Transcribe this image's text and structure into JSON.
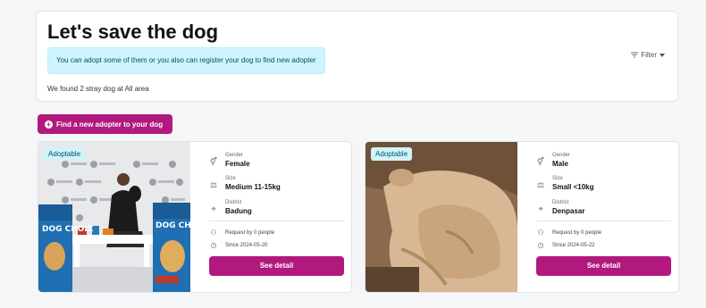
{
  "header": {
    "title": "Let's save the dog",
    "info_message": "You can adopt some of them or you also can register your dog to find new adopter",
    "result_text": "We found 2 stray dog at All area",
    "filter_label": "Filter"
  },
  "cta": {
    "label": "Find a new adopter to your dog"
  },
  "labels": {
    "gender": "Gender",
    "size": "Size",
    "district": "District",
    "see_detail": "See detail"
  },
  "dogs": [
    {
      "badge": "Adoptable",
      "gender": "Female",
      "size": "Medium 11-15kg",
      "district": "Badung",
      "requests": "Request by 0 people",
      "since": "Since 2024-05-20",
      "photo_banner_text": "DOG CHOIZ"
    },
    {
      "badge": "Adoptable",
      "gender": "Male",
      "size": "Small <10kg",
      "district": "Denpasar",
      "requests": "Request by 0 people",
      "since": "Since 2024-05-22"
    }
  ],
  "colors": {
    "primary": "#b2197f",
    "info_bg": "#cff4fc",
    "info_text": "#055160",
    "page_bg": "#f5f6f8"
  },
  "icons": {
    "gender": "gender-icon",
    "size": "weight-icon",
    "district": "location-pin-icon",
    "requests": "person-icon",
    "since": "clock-icon",
    "filter": "filter-lines-icon",
    "cta": "plus-circle-icon"
  }
}
